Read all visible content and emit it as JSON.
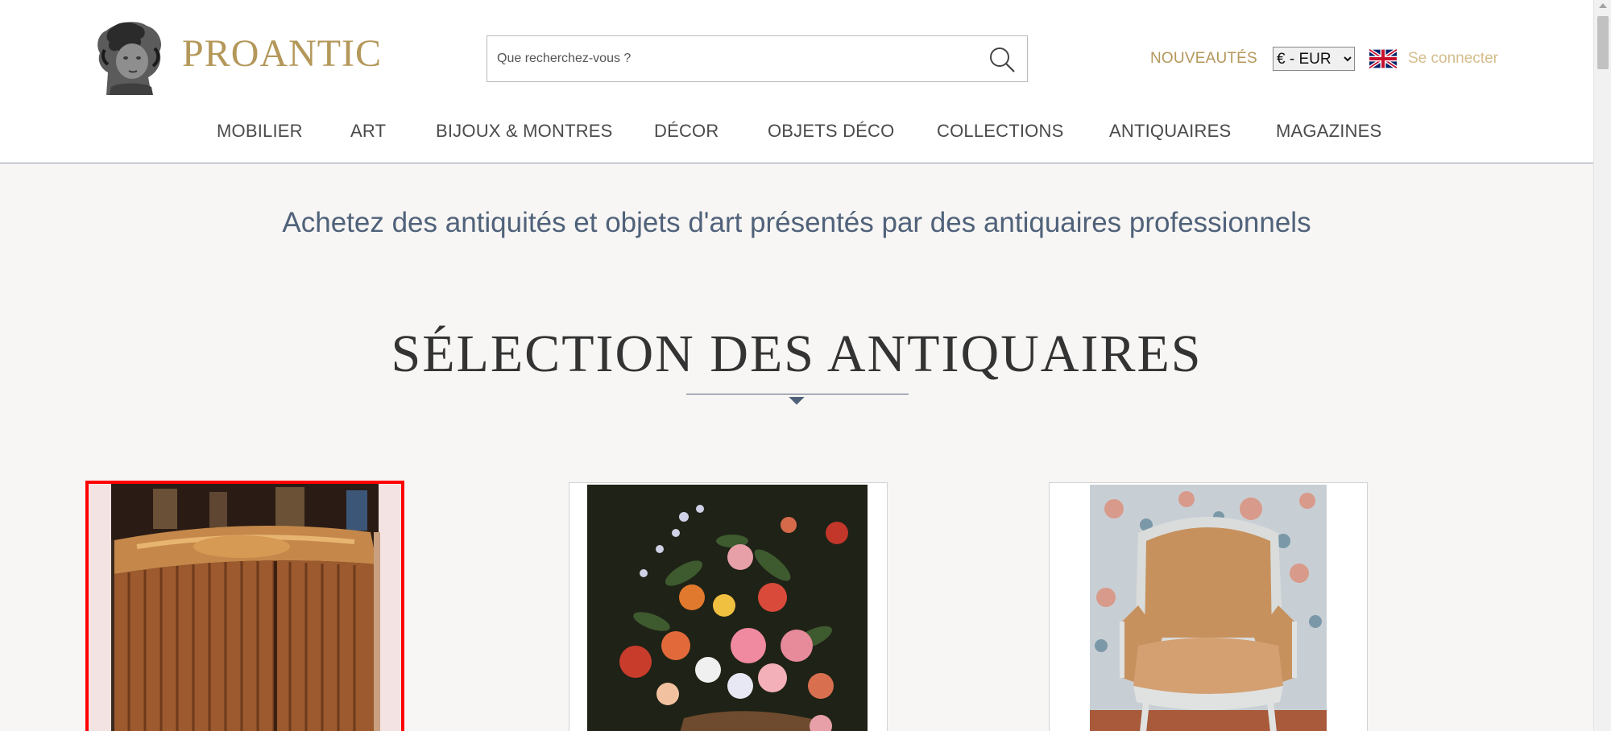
{
  "header": {
    "logo_text": "PROANTIC",
    "search_placeholder": "Que recherchez-vous ?",
    "nouveautes": "NOUVEAUTÉS",
    "currency_selected": "€ - EUR",
    "language_flag": "uk-flag-icon",
    "connect": "Se connecter",
    "accent_color": "#b4985a"
  },
  "nav": {
    "items": [
      {
        "label": "MOBILIER"
      },
      {
        "label": "ART"
      },
      {
        "label": "BIJOUX & MONTRES"
      },
      {
        "label": "DÉCOR"
      },
      {
        "label": "OBJETS DÉCO"
      },
      {
        "label": "COLLECTIONS"
      },
      {
        "label": "ANTIQUAIRES"
      },
      {
        "label": "MAGAZINES"
      }
    ]
  },
  "main": {
    "tagline": "Achetez des antiquités et objets d'art présentés par des antiquaires professionnels",
    "section_title": "SÉLECTION DES ANTIQUAIRES",
    "title_color": "#50627a"
  },
  "cards": [
    {
      "subject": "demi-lune marquetry commode",
      "selected": true
    },
    {
      "subject": "flower still life painting",
      "selected": false
    },
    {
      "subject": "upholstered bergère armchair",
      "selected": false
    }
  ]
}
